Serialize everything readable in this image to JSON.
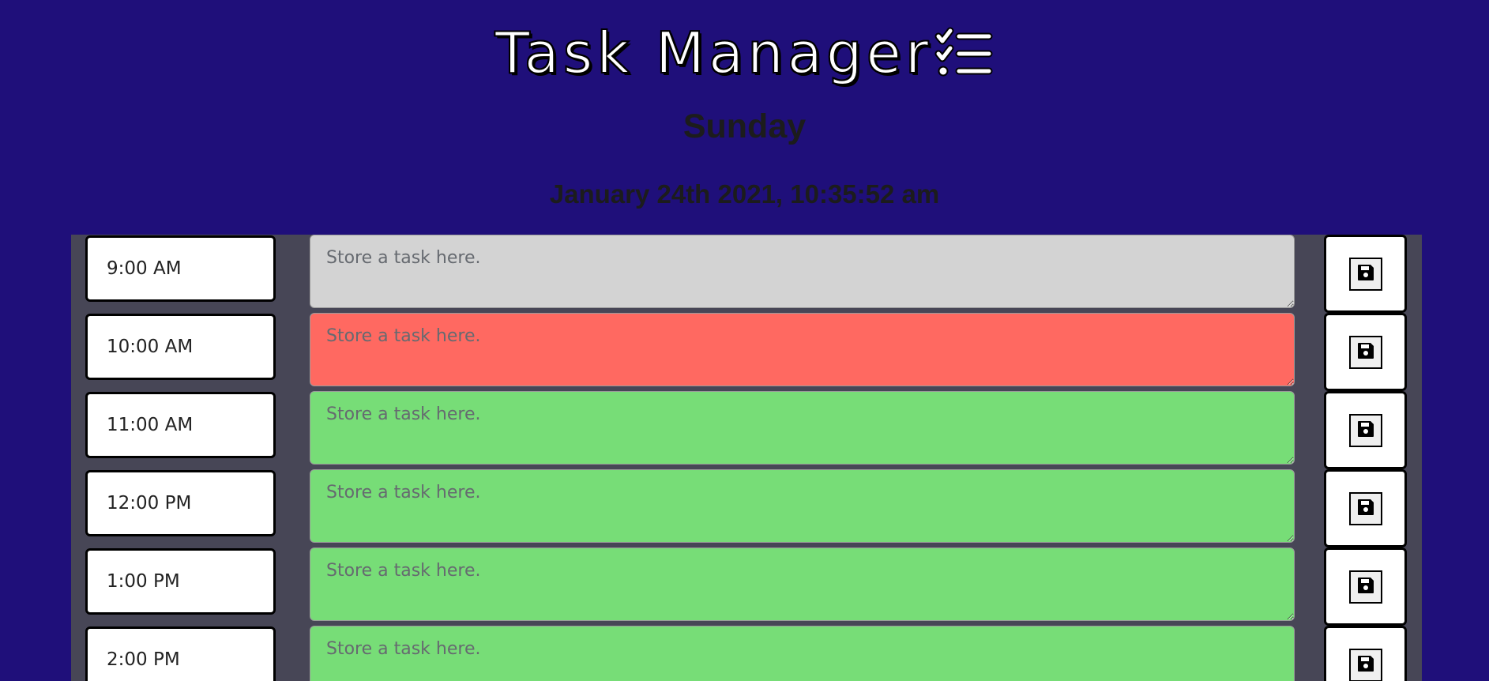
{
  "header": {
    "title": "Task Manager",
    "title_icon": "checklist-icon",
    "day": "Sunday",
    "datetime": "January 24th 2021, 10:35:52 am"
  },
  "rows": [
    {
      "hour": "9:00 AM",
      "placeholder": "Store a task here.",
      "status": "past",
      "save_icon": "floppy-disk-icon"
    },
    {
      "hour": "10:00 AM",
      "placeholder": "Store a task here.",
      "status": "present",
      "save_icon": "floppy-disk-icon"
    },
    {
      "hour": "11:00 AM",
      "placeholder": "Store a task here.",
      "status": "future",
      "save_icon": "floppy-disk-icon"
    },
    {
      "hour": "12:00 PM",
      "placeholder": "Store a task here.",
      "status": "future",
      "save_icon": "floppy-disk-icon"
    },
    {
      "hour": "1:00 PM",
      "placeholder": "Store a task here.",
      "status": "future",
      "save_icon": "floppy-disk-icon"
    },
    {
      "hour": "2:00 PM",
      "placeholder": "Store a task here.",
      "status": "future",
      "save_icon": "floppy-disk-icon"
    }
  ],
  "colors": {
    "background": "#1f0f7a",
    "planner_bg": "#474656",
    "past": "#d3d3d3",
    "present": "#ff6961",
    "future": "#77dd77"
  }
}
